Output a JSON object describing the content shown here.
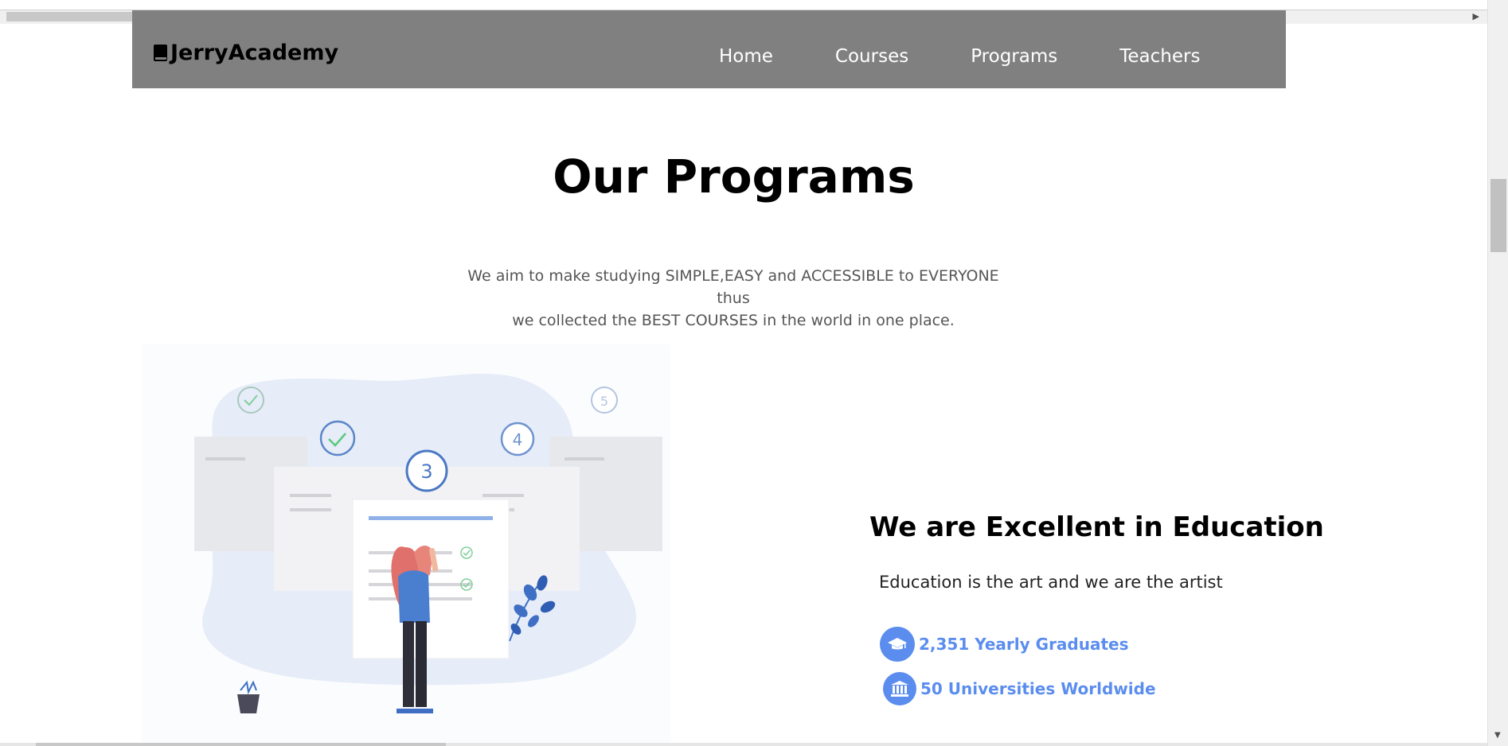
{
  "header": {
    "brand": "JerryAcademy",
    "nav": [
      "Home",
      "Courses",
      "Programs",
      "Teachers"
    ]
  },
  "programs": {
    "title": "Our Programs",
    "description_line1": "We aim to make studying SIMPLE,EASY and ACCESSIBLE to EVERYONE thus",
    "description_line2": "we collected the BEST COURSES in the world in one place."
  },
  "illustration": {
    "step_numbers": [
      "3",
      "4",
      "5"
    ]
  },
  "excellence": {
    "title": "We are Excellent in Education",
    "subtitle": "Education is the art and we are the artist",
    "stats": [
      {
        "icon": "graduation-cap-icon",
        "label": "2,351 Yearly Graduates"
      },
      {
        "icon": "university-icon",
        "label": "50 Universities Worldwide"
      }
    ]
  },
  "colors": {
    "navbar": "#808080",
    "accent": "#5b8def",
    "illustration_blob": "#e6ecf8"
  }
}
